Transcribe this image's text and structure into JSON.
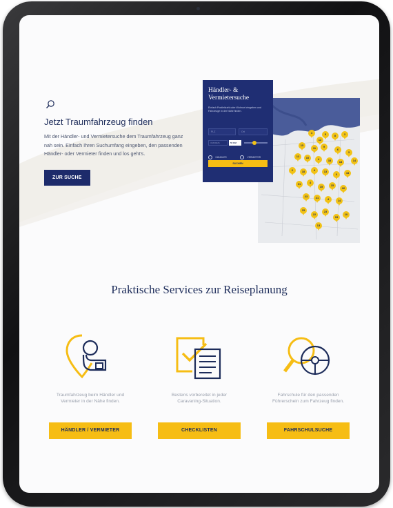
{
  "hero": {
    "title": "Jetzt Traumfahrzeug finden",
    "text": "Mit der Händler- und Vermietersuche dem Traumfahrzeug ganz nah sein. Einfach Ihren Suchumfang eingeben, den passenden Händler- oder Vermieter finden und los geht's.",
    "button": "ZUR SUCHE"
  },
  "search_panel": {
    "title_line1": "Händler- &",
    "title_line2": "Vermietersuche",
    "text": "Einfach Postleitzahl oder Wohnort eingeben und Fahrzeuge in der Nähe finden.",
    "plz_placeholder": "PLZ",
    "ort_placeholder": "Ort",
    "umkreis_placeholder": "UMKREIS",
    "radius_value": "50 KM",
    "option_haendler": "HÄNDLER",
    "option_vermieter": "VERMIETER",
    "submit": "SUCHEN"
  },
  "map": {
    "pins": [
      "4",
      "12",
      "5",
      "8",
      "3",
      "15",
      "11",
      "9",
      "6",
      "3",
      "12",
      "10",
      "4",
      "33",
      "18",
      "14",
      "2",
      "18",
      "4",
      "13",
      "6",
      "44",
      "31",
      "4",
      "15",
      "15",
      "26",
      "23",
      "21",
      "4",
      "14",
      "15",
      "22",
      "23",
      "15",
      "10",
      "13"
    ]
  },
  "services": {
    "title": "Praktische Services zur Reiseplanung",
    "items": [
      {
        "icon": "location-pin-car-icon",
        "text": "Traumfahrzeug beim Händler und Vermieter in der Nähe finden.",
        "button": "HÄNDLER / VERMIETER"
      },
      {
        "icon": "checklist-icon",
        "text": "Bestens vorbereitet in jeder Caravaning-Situation.",
        "button": "CHECKLISTEN"
      },
      {
        "icon": "magnifier-steering-wheel-icon",
        "text": "Fahrschule für den passenden Führerschein zum Fahrzeug finden.",
        "button": "FAHRSCHULSUCHE"
      }
    ]
  },
  "colors": {
    "navy": "#1d2b6b",
    "yellow": "#f6bd14",
    "text_navy": "#1d2c5a"
  }
}
